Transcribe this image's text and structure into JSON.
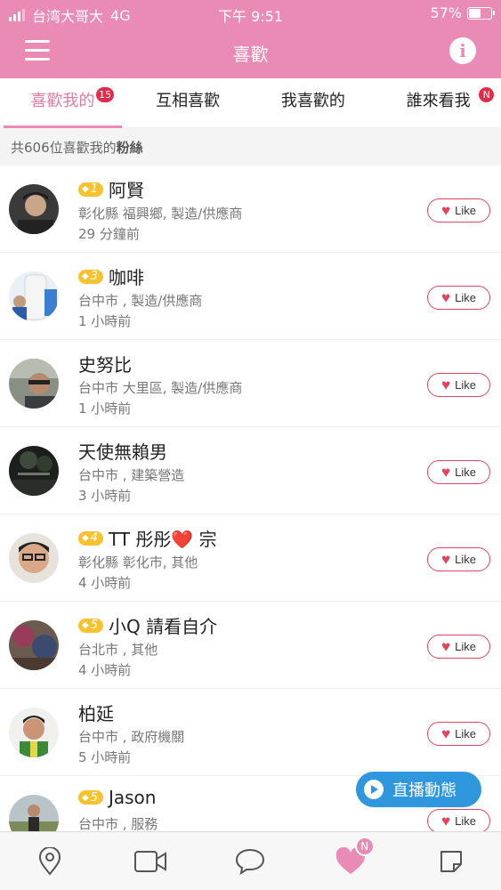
{
  "status_bar": {
    "carrier": "台湾大哥大",
    "network": "4G",
    "time": "下午 9:51",
    "battery": "57%",
    "battery_level": 0.57
  },
  "header": {
    "title": "喜歡",
    "menu_icon": "menu-icon",
    "info_icon": "info-icon"
  },
  "tabs": [
    {
      "label": "喜歡我的",
      "badge": "15",
      "active": true
    },
    {
      "label": "互相喜歡",
      "badge": "",
      "active": false
    },
    {
      "label": "我喜歡的",
      "badge": "",
      "active": false
    },
    {
      "label": "誰來看我",
      "badge": "N",
      "active": false
    }
  ],
  "summary": {
    "prefix": "共606位喜歡我的",
    "emphasis": "粉絲"
  },
  "users": [
    {
      "level": "1",
      "name": "阿賢",
      "location": "彰化縣 福興鄉, 製造/供應商",
      "time_ago": "29 分鐘前",
      "like_label": "Like"
    },
    {
      "level": "3",
      "name": "咖啡",
      "location": "台中市 , 製造/供應商",
      "time_ago": "1 小時前",
      "like_label": "Like"
    },
    {
      "level": "",
      "name": "史努比",
      "location": "台中市 大里區, 製造/供應商",
      "time_ago": "1 小時前",
      "like_label": "Like"
    },
    {
      "level": "",
      "name": "天使無賴男",
      "location": "台中市 , 建築營造",
      "time_ago": "3 小時前",
      "like_label": "Like"
    },
    {
      "level": "4",
      "name": "TT 彤彤❤️ 宗",
      "location": "彰化縣 彰化市, 其他",
      "time_ago": "4 小時前",
      "like_label": "Like"
    },
    {
      "level": "5",
      "name": "小Q 請看自介",
      "location": "台北市 , 其他",
      "time_ago": "4 小時前",
      "like_label": "Like"
    },
    {
      "level": "",
      "name": "柏延",
      "location": "台中市 , 政府機關",
      "time_ago": "5 小時前",
      "like_label": "Like"
    },
    {
      "level": "5",
      "name": "Jason",
      "location": "台中市 , 服務",
      "time_ago": "",
      "like_label": "Like"
    }
  ],
  "live_button": {
    "label": "直播動態"
  },
  "bottom_nav": [
    {
      "icon": "location-pin-icon"
    },
    {
      "icon": "video-camera-icon"
    },
    {
      "icon": "chat-bubble-icon"
    },
    {
      "icon": "heart-icon",
      "badge": "N",
      "active": true
    },
    {
      "icon": "note-icon"
    }
  ],
  "colors": {
    "brand_pink": "#e98bb5",
    "like_red": "#e2445f",
    "live_blue": "#2f97dd",
    "level_gold": "#f8c22f"
  }
}
